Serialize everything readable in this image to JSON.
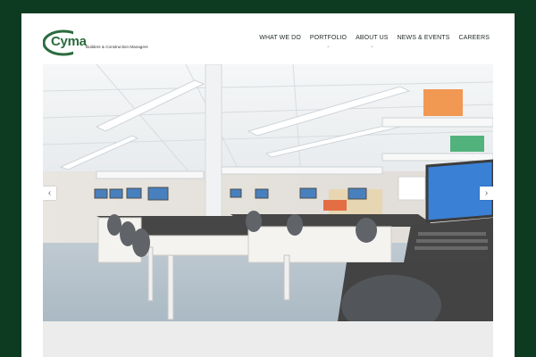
{
  "brand": {
    "name": "Cyma",
    "tagline": "Builders & Construction Managers",
    "color": "#2b6b3e"
  },
  "nav": [
    {
      "label": "WHAT WE DO",
      "has_dropdown": false
    },
    {
      "label": "PORTFOLIO",
      "has_dropdown": true
    },
    {
      "label": "ABOUT US",
      "has_dropdown": true
    },
    {
      "label": "NEWS & EVENTS",
      "has_dropdown": false
    },
    {
      "label": "CAREERS",
      "has_dropdown": false
    }
  ],
  "slider": {
    "prev_icon": "chevron-left-icon",
    "next_icon": "chevron-right-icon",
    "prev_glyph": "‹",
    "next_glyph": "›",
    "image_subject": "laboratory-interior"
  },
  "colors": {
    "frame_background": "#0d3b22",
    "page_background": "#ffffff"
  }
}
